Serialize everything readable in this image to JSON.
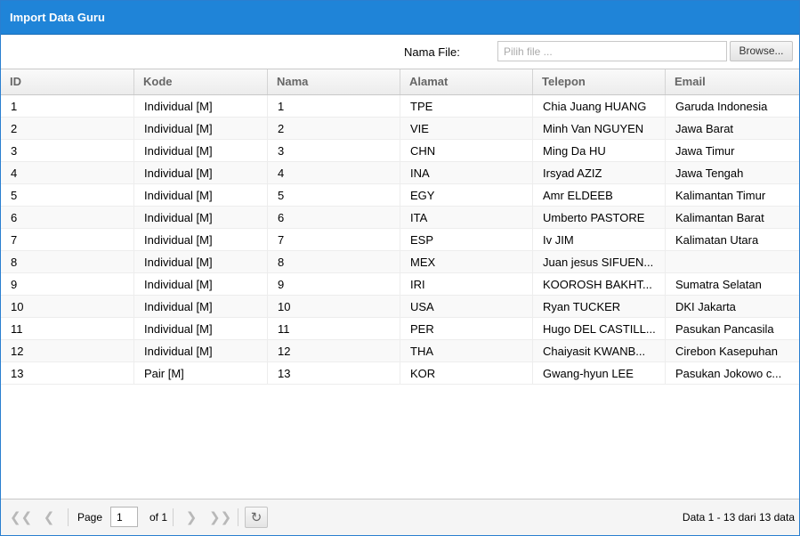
{
  "window": {
    "title": "Import Data Guru"
  },
  "file": {
    "label": "Nama File:",
    "placeholder": "Pilih file ...",
    "browse_label": "Browse..."
  },
  "grid": {
    "columns": [
      "ID",
      "Kode",
      "Nama",
      "Alamat",
      "Telepon",
      "Email"
    ],
    "rows": [
      [
        "1",
        "Individual [M]",
        "1",
        "TPE",
        "Chia Juang HUANG",
        "Garuda Indonesia"
      ],
      [
        "2",
        "Individual [M]",
        "2",
        "VIE",
        "Minh Van NGUYEN",
        "Jawa Barat"
      ],
      [
        "3",
        "Individual [M]",
        "3",
        "CHN",
        "Ming Da HU",
        "Jawa Timur"
      ],
      [
        "4",
        "Individual [M]",
        "4",
        "INA",
        "Irsyad AZIZ",
        "Jawa Tengah"
      ],
      [
        "5",
        "Individual [M]",
        "5",
        "EGY",
        "Amr ELDEEB",
        "Kalimantan Timur"
      ],
      [
        "6",
        "Individual [M]",
        "6",
        "ITA",
        "Umberto PASTORE",
        "Kalimantan Barat"
      ],
      [
        "7",
        "Individual [M]",
        "7",
        "ESP",
        "Iv JIM",
        "Kalimatan Utara"
      ],
      [
        "8",
        "Individual [M]",
        "8",
        "MEX",
        "Juan jesus SIFUEN...",
        ""
      ],
      [
        "9",
        "Individual [M]",
        "9",
        "IRI",
        "KOOROSH BAKHT...",
        "Sumatra Selatan"
      ],
      [
        "10",
        "Individual [M]",
        "10",
        "USA",
        "Ryan TUCKER",
        "DKI Jakarta"
      ],
      [
        "11",
        "Individual [M]",
        "11",
        "PER",
        "Hugo DEL CASTILL...",
        "Pasukan Pancasila"
      ],
      [
        "12",
        "Individual [M]",
        "12",
        "THA",
        "Chaiyasit KWANB...",
        "Cirebon Kasepuhan"
      ],
      [
        "13",
        "Pair [M]",
        "13",
        "KOR",
        "Gwang-hyun LEE",
        "Pasukan Jokowo c..."
      ]
    ]
  },
  "pager": {
    "page_label": "Page",
    "current_page": "1",
    "of_label": "of 1",
    "display_info": "Data 1 - 13 dari 13 data",
    "icons": {
      "first": "first-page-icon",
      "prev": "prev-page-icon",
      "next": "next-page-icon",
      "last": "last-page-icon",
      "refresh": "refresh-icon"
    }
  }
}
